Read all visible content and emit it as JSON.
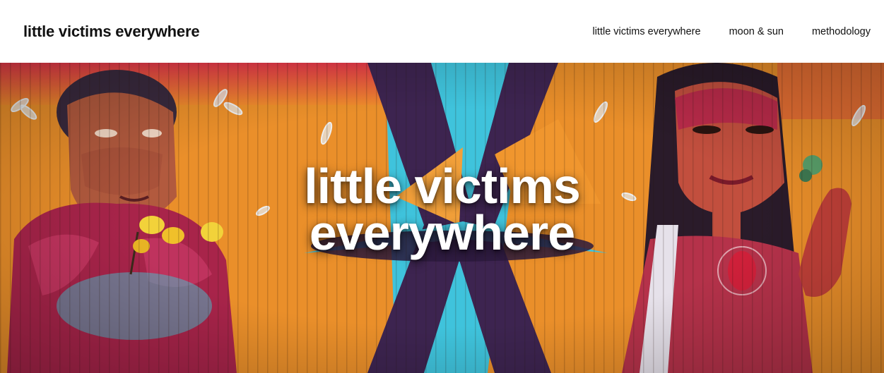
{
  "header": {
    "site_title": "little victims everywhere",
    "nav": [
      {
        "label": "little victims everywhere"
      },
      {
        "label": "moon & sun"
      },
      {
        "label": "methodology"
      }
    ]
  },
  "hero": {
    "title_line1": "little victims",
    "title_line2": "everywhere",
    "image": "mural-painted-wall",
    "colors": {
      "orange": "#ea8f2a",
      "purple": "#3d2450",
      "cyan": "#3fc3dc",
      "magenta": "#c0265a"
    }
  }
}
